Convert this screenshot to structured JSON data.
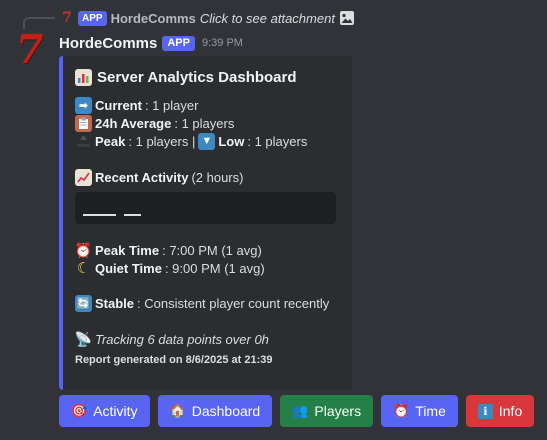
{
  "reply": {
    "badge": "APP",
    "username": "HordeComms",
    "content": "Click to see attachment"
  },
  "message": {
    "username": "HordeComms",
    "badge": "APP",
    "timestamp": "9:39 PM"
  },
  "embed": {
    "title": "Server Analytics Dashboard",
    "accent_color": "#5865f2",
    "current_label": "Current",
    "current_value": ": 1 player",
    "average_label": "24h Average",
    "average_value": ": 1 players",
    "peak_label": "Peak",
    "peak_value": ": 1 players |",
    "low_label": "Low",
    "low_value": ": 1 players",
    "activity_label": "Recent Activity",
    "activity_period": "(2 hours)",
    "peak_time_label": "Peak Time",
    "peak_time_value": ": 7:00 PM (1 avg)",
    "quiet_time_label": "Quiet Time",
    "quiet_time_value": ": 9:00 PM (1 avg)",
    "stable_label": "Stable",
    "stable_value": ": Consistent player count recently",
    "tracking_text": "Tracking 6 data points over 0h",
    "footer": "Report generated on 8/6/2025 at 21:39"
  },
  "buttons": [
    {
      "label": "Activity",
      "icon": "🎯",
      "style": "primary"
    },
    {
      "label": "Dashboard",
      "icon": "🏠",
      "style": "primary"
    },
    {
      "label": "Players",
      "icon": "👥",
      "style": "success"
    },
    {
      "label": "Time",
      "icon": "⏰",
      "style": "primary"
    },
    {
      "label": "Info",
      "icon": "ℹ",
      "style": "danger"
    }
  ],
  "colors": {
    "background": "#313338",
    "embed_bg": "#2b2d31",
    "blurple": "#5865f2",
    "green": "#248046",
    "red": "#da373c"
  }
}
